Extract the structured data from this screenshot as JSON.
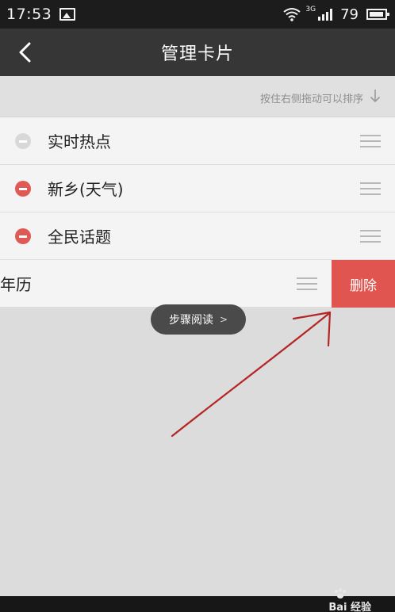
{
  "status_bar": {
    "time": "17:53",
    "network": "3G",
    "battery": "79"
  },
  "header": {
    "title": "管理卡片"
  },
  "hint": {
    "text": "按住右侧拖动可以排序"
  },
  "cards": [
    {
      "label": "实时热点",
      "removable": false
    },
    {
      "label": "新乡(天气)",
      "removable": true
    },
    {
      "label": "全民话题",
      "removable": true
    },
    {
      "label": "年历",
      "swiped": true,
      "delete_label": "删除"
    }
  ],
  "overlay": {
    "step_read_label": "步骤阅读"
  },
  "watermark": {
    "text": "Bai 经验"
  },
  "colors": {
    "accent_red": "#e05550",
    "title_bar": "#363636",
    "status_bar": "#1c1c1c",
    "annotation_arrow": "#b42525"
  }
}
